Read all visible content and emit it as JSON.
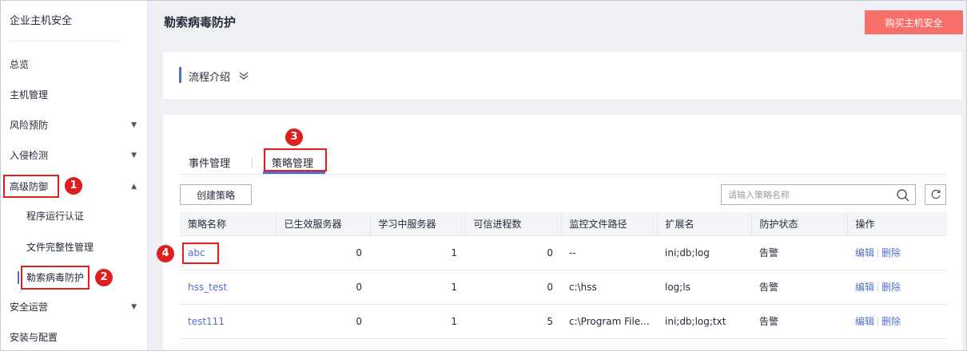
{
  "sidebar": {
    "title": "企业主机安全",
    "items": [
      {
        "label": "总览",
        "caret": ""
      },
      {
        "label": "主机管理",
        "caret": ""
      },
      {
        "label": "风险预防",
        "caret": "▼"
      },
      {
        "label": "入侵检测",
        "caret": "▼"
      },
      {
        "label": "高级防御",
        "caret": "▲"
      },
      {
        "label": "安全运营",
        "caret": "▼"
      },
      {
        "label": "安装与配置",
        "caret": ""
      }
    ],
    "sub_items": [
      {
        "label": "程序运行认证"
      },
      {
        "label": "文件完整性管理"
      },
      {
        "label": "勒索病毒防护"
      }
    ]
  },
  "header": {
    "title": "勒索病毒防护",
    "buy_button": "购买主机安全"
  },
  "process": {
    "label": "流程介绍",
    "chevron": "≫"
  },
  "tabs": [
    {
      "label": "事件管理"
    },
    {
      "label": "策略管理"
    }
  ],
  "toolbar": {
    "create_button": "创建策略",
    "search_placeholder": "请输入策略名称"
  },
  "table": {
    "columns": [
      "策略名称",
      "已生效服务器",
      "学习中服务器",
      "可信进程数",
      "监控文件路径",
      "扩展名",
      "防护状态",
      "操作"
    ],
    "rows": [
      {
        "name": "abc",
        "active": "0",
        "learning": "1",
        "trusted": "0",
        "path": "--",
        "ext": "ini;db;log",
        "status": "告警",
        "edit": "编辑",
        "delete": "删除"
      },
      {
        "name": "hss_test",
        "active": "0",
        "learning": "1",
        "trusted": "0",
        "path": "c:\\hss",
        "ext": "log;ls",
        "status": "告警",
        "edit": "编辑",
        "delete": "删除"
      },
      {
        "name": "test111",
        "active": "0",
        "learning": "1",
        "trusted": "5",
        "path": "c:\\Program File...",
        "ext": "ini;db;log;txt",
        "status": "告警",
        "edit": "编辑",
        "delete": "删除"
      }
    ]
  },
  "markers": [
    "1",
    "2",
    "3",
    "4"
  ],
  "colors": {
    "accent": "#526ecc",
    "buy_button": "#f66f6a",
    "highlight": "#e01e1e"
  }
}
